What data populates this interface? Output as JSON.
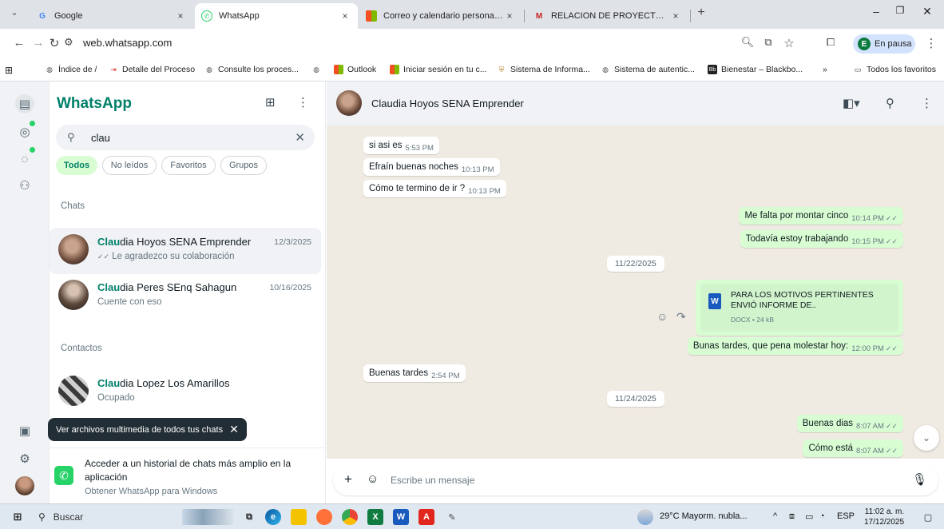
{
  "browser": {
    "tabs": [
      {
        "title": "Google",
        "favicon": "G",
        "favicon_color": "#4285f4",
        "active": false
      },
      {
        "title": "WhatsApp",
        "favicon": "✆",
        "favicon_color": "#25d366",
        "active": true
      },
      {
        "title": "Correo y calendario personal de",
        "favicon": "■",
        "favicon_color": "#f25022",
        "active": false
      },
      {
        "title": "RELACION DE PROYECTOS EVAL",
        "favicon": "M",
        "favicon_color": "#c5221f",
        "active": false
      }
    ],
    "new_tab_glyph": "+",
    "url": "web.whatsapp.com",
    "profile_initial": "E",
    "profile_label": "En pausa",
    "bookmarks": [
      {
        "label": "Índice de /",
        "icon_color": "#555"
      },
      {
        "label": "Detalle del Proceso",
        "icon_color": "#d93025"
      },
      {
        "label": "Consulte los proces...",
        "icon_color": "#555"
      },
      {
        "label": "",
        "icon_color": "#555"
      },
      {
        "label": "Outlook",
        "icon_color": "#f25022"
      },
      {
        "label": "Iniciar sesión en tu c...",
        "icon_color": "#f25022"
      },
      {
        "label": "Sistema de Informa...",
        "icon_color": "#b8862b"
      },
      {
        "label": "Sistema de autentic...",
        "icon_color": "#555"
      },
      {
        "label": "Bienestar – Blackbo...",
        "icon_color": "#222"
      }
    ],
    "bookmarks_more": "»",
    "all_bookmarks": "Todos los favoritos"
  },
  "whatsapp": {
    "brand": "WhatsApp",
    "search": {
      "value": "clau"
    },
    "filters": [
      "Todos",
      "No leídos",
      "Favoritos",
      "Grupos"
    ],
    "active_filter": 0,
    "section_chats": "Chats",
    "section_contacts": "Contactos",
    "chats": [
      {
        "match": "Clau",
        "rest": "dia Hoyos SENA Emprender",
        "date": "12/3/2025",
        "preview": "Le agradezco su colaboración",
        "ticks": "✓✓"
      },
      {
        "match": "Clau",
        "rest": "dia Peres SEnq Sahagun",
        "date": "10/16/2025",
        "preview": "Cuente con eso",
        "ticks": ""
      }
    ],
    "contacts": [
      {
        "match": "Clau",
        "rest": "dia Lopez Los Amarillos",
        "status": "Ocupado"
      }
    ],
    "tooltip": "Ver archivos multimedia de todos tus chats",
    "promo": {
      "title": "Acceder a un historial de chats más amplio en la aplicación",
      "subtitle": "Obtener WhatsApp para Windows"
    },
    "header_name": "Claudia Hoyos SENA Emprender",
    "messages": [
      {
        "text": "si asi es",
        "time": "5:53 PM",
        "dir": "in"
      },
      {
        "text": "Efraín buenas noches",
        "time": "10:13 PM",
        "dir": "in"
      },
      {
        "text": "Cómo te termino de ir ?",
        "time": "10:13 PM",
        "dir": "in"
      },
      {
        "text": "Me falta por montar cinco",
        "time": "10:14 PM",
        "dir": "out"
      },
      {
        "text": "Todavía estoy trabajando",
        "time": "10:15 PM",
        "dir": "out"
      },
      {
        "text": "Bunas tardes, que pena molestar hoy:",
        "time": "12:00 PM",
        "dir": "out"
      },
      {
        "text": "Buenas tardes",
        "time": "2:54 PM",
        "dir": "in"
      },
      {
        "text": "Buenas dias",
        "time": "8:07 AM",
        "dir": "out"
      },
      {
        "text": "Cómo está",
        "time": "8:07 AM",
        "dir": "out"
      }
    ],
    "dates": [
      "11/22/2025",
      "11/24/2025"
    ],
    "document": {
      "name": "PARA LOS MOTIVOS PERTINENTES ENVIÓ INFORME DE..",
      "meta": "DOCX • 24 kB"
    },
    "composer_placeholder": "Escribe un mensaje"
  },
  "taskbar": {
    "search_label": "Buscar",
    "weather": "29°C  Mayorm. nubla...",
    "lang": "ESP",
    "time": "11:02 a. m.",
    "date": "17/12/2025"
  }
}
